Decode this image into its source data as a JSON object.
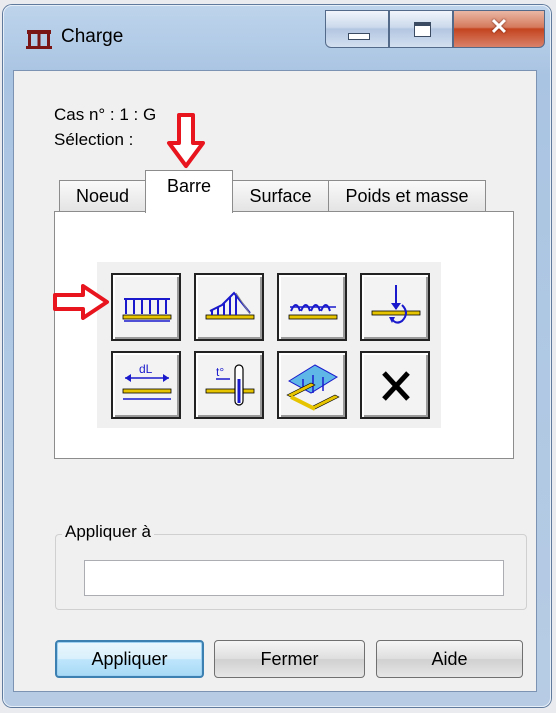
{
  "window": {
    "title": "Charge",
    "icon": "load-grid-icon"
  },
  "header": {
    "case_label": "Cas n° : 1 : G",
    "selection_label": "Sélection :"
  },
  "tabs": [
    {
      "label": "Noeud",
      "active": false
    },
    {
      "label": "Barre",
      "active": true
    },
    {
      "label": "Surface",
      "active": false
    },
    {
      "label": "Poids et masse",
      "active": false
    }
  ],
  "load_icons": [
    {
      "icon": "uniform-load-icon"
    },
    {
      "icon": "trapezoidal-load-icon"
    },
    {
      "icon": "moment-load-icon"
    },
    {
      "icon": "concentrated-force-icon"
    },
    {
      "icon": "elongation-load-icon"
    },
    {
      "icon": "thermal-load-icon"
    },
    {
      "icon": "surface-load-on-bar-icon"
    },
    {
      "icon": "delete-load-icon"
    }
  ],
  "apply_group": {
    "legend": "Appliquer à",
    "value": ""
  },
  "buttons": {
    "apply": "Appliquer",
    "close": "Fermer",
    "help": "Aide"
  },
  "colors": {
    "annotation_arrow": "#e8141e",
    "icon_beam": "#e6c400",
    "icon_load": "#1a1acc",
    "accent": "#3c7fb1"
  }
}
